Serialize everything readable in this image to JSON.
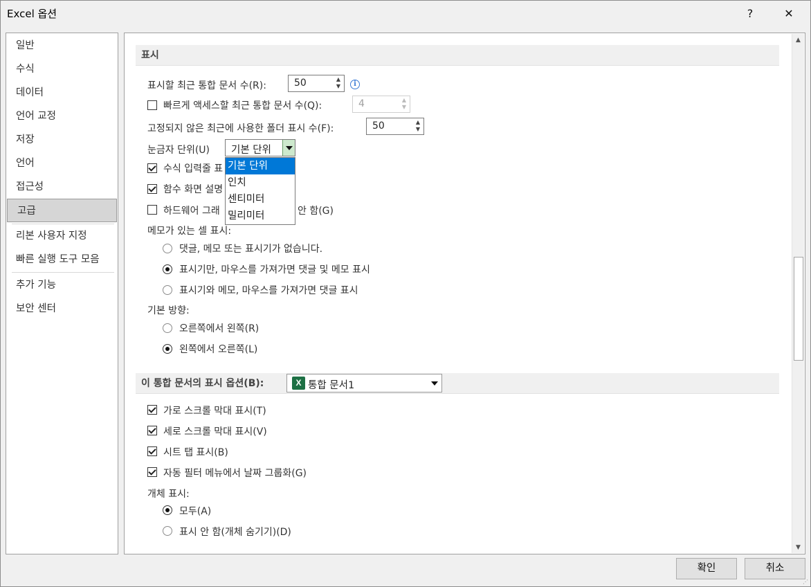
{
  "window": {
    "title": "Excel 옵션",
    "help_glyph": "?",
    "close_glyph": "✕"
  },
  "sidebar": {
    "items": [
      {
        "label": "일반"
      },
      {
        "label": "수식"
      },
      {
        "label": "데이터"
      },
      {
        "label": "언어 교정"
      },
      {
        "label": "저장"
      },
      {
        "label": "언어"
      },
      {
        "label": "접근성"
      },
      {
        "label": "고급",
        "active": true
      },
      {
        "label": "리본 사용자 지정"
      },
      {
        "label": "빠른 실행 도구 모음"
      },
      {
        "label": "추가 기능"
      },
      {
        "label": "보안 센터"
      }
    ]
  },
  "display": {
    "header": "표시",
    "recent_docs": {
      "label": "표시할 최근 통합 문서 수(R):",
      "value": "50"
    },
    "quick_access": {
      "label": "빠르게 액세스할 최근 통합 문서 수(Q):",
      "value": "4",
      "checked": false
    },
    "recent_folders": {
      "label": "고정되지 않은 최근에 사용한 폴더 표시 수(F):",
      "value": "50"
    },
    "ruler_units": {
      "label": "눈금자 단위(U)",
      "selected": "기본 단위",
      "options": [
        "기본 단위",
        "인치",
        "센티미터",
        "밀리미터"
      ]
    },
    "formula_bar": {
      "label": "수식 입력줄 표",
      "checked": true
    },
    "function_tips": {
      "label": "함수 화면 설명",
      "checked": true
    },
    "hw_accel": {
      "label": "하드웨어 그래",
      "label_tail": "안 함(G)",
      "checked": false
    },
    "comments_label": "메모가 있는 셀 표시:",
    "comment_opts": [
      {
        "label": "댓글, 메모 또는 표시기가 없습니다.",
        "on": false
      },
      {
        "label": "표시기만, 마우스를 가져가면 댓글 및 메모 표시",
        "on": true
      },
      {
        "label": "표시기와 메모, 마우스를 가져가면 댓글 표시",
        "on": false
      }
    ],
    "direction_label": "기본 방향:",
    "direction_opts": [
      {
        "label": "오른쪽에서 왼쪽(R)",
        "on": false
      },
      {
        "label": "왼쪽에서 오른쪽(L)",
        "on": true
      }
    ]
  },
  "workbook": {
    "header": "이 통합 문서의 표시 옵션(B):",
    "selected": "통합 문서1",
    "icon_letter": "X",
    "checks": [
      {
        "label": "가로 스크롤 막대 표시(T)",
        "checked": true
      },
      {
        "label": "세로 스크롤 막대 표시(V)",
        "checked": true
      },
      {
        "label": "시트 탭 표시(B)",
        "checked": true
      },
      {
        "label": "자동 필터 메뉴에서 날짜 그룹화(G)",
        "checked": true
      }
    ],
    "objects_label": "개체 표시:",
    "object_opts": [
      {
        "label": "모두(A)",
        "on": true
      },
      {
        "label": "표시 안 함(개체 숨기기)(D)",
        "on": false
      }
    ]
  },
  "footer": {
    "ok": "확인",
    "cancel": "취소"
  }
}
